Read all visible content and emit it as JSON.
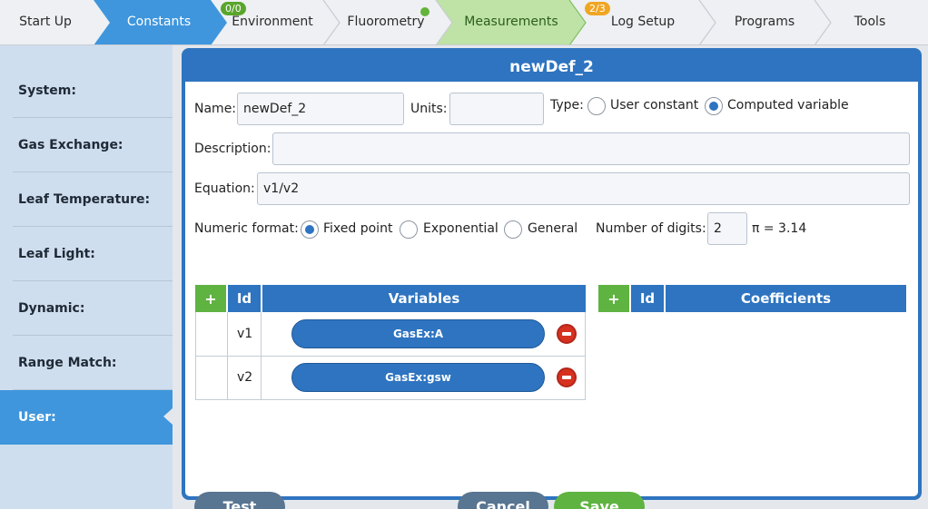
{
  "nav": {
    "tabs": [
      {
        "label": "Start Up"
      },
      {
        "label": "Constants"
      },
      {
        "label": "Environment",
        "badge": "0/0"
      },
      {
        "label": "Fluorometry"
      },
      {
        "label": "Measurements"
      },
      {
        "label": "Log Setup",
        "badge": "2/3"
      },
      {
        "label": "Programs"
      },
      {
        "label": "Tools"
      }
    ],
    "active": "Constants"
  },
  "sidebar": {
    "items": [
      {
        "label": "System:"
      },
      {
        "label": "Gas Exchange:"
      },
      {
        "label": "Leaf Temperature:"
      },
      {
        "label": "Leaf Light:"
      },
      {
        "label": "Dynamic:"
      },
      {
        "label": "Range Match:"
      },
      {
        "label": "User:"
      }
    ],
    "active": "User:"
  },
  "dialog": {
    "title": "newDef_2",
    "name_label": "Name:",
    "name_value": "newDef_2",
    "units_label": "Units:",
    "units_value": "",
    "type_label": "Type:",
    "type_options": [
      "User constant",
      "Computed variable"
    ],
    "type_selected": "Computed variable",
    "description_label": "Description:",
    "description_value": "",
    "equation_label": "Equation:",
    "equation_value": "v1/v2",
    "numeric_format_label": "Numeric format:",
    "numeric_format_options": [
      "Fixed point",
      "Exponential",
      "General"
    ],
    "numeric_format_selected": "Fixed point",
    "digits_label": "Number of digits:",
    "digits_value": "2",
    "pi_preview": "π = 3.14",
    "variables_table": {
      "add_label": "+",
      "headers": [
        "Id",
        "Variables"
      ],
      "rows": [
        {
          "id": "v1",
          "variable": "GasEx:A"
        },
        {
          "id": "v2",
          "variable": "GasEx:gsw"
        }
      ]
    },
    "coefficients_table": {
      "add_label": "+",
      "headers": [
        "Id",
        "Coefficients"
      ],
      "rows": []
    },
    "buttons": {
      "test": "Test",
      "cancel": "Cancel",
      "save": "Save"
    }
  },
  "colors": {
    "accent_blue": "#2e74c0",
    "active_tab_blue": "#3f96dc",
    "success_green": "#5fb341",
    "measurements_tab_green": "#bfe3a6",
    "remove_red": "#d6321f",
    "badge_orange": "#f0a623"
  },
  "icons": {
    "remove": "remove-circle-icon",
    "status_dot": "status-dot-icon"
  }
}
